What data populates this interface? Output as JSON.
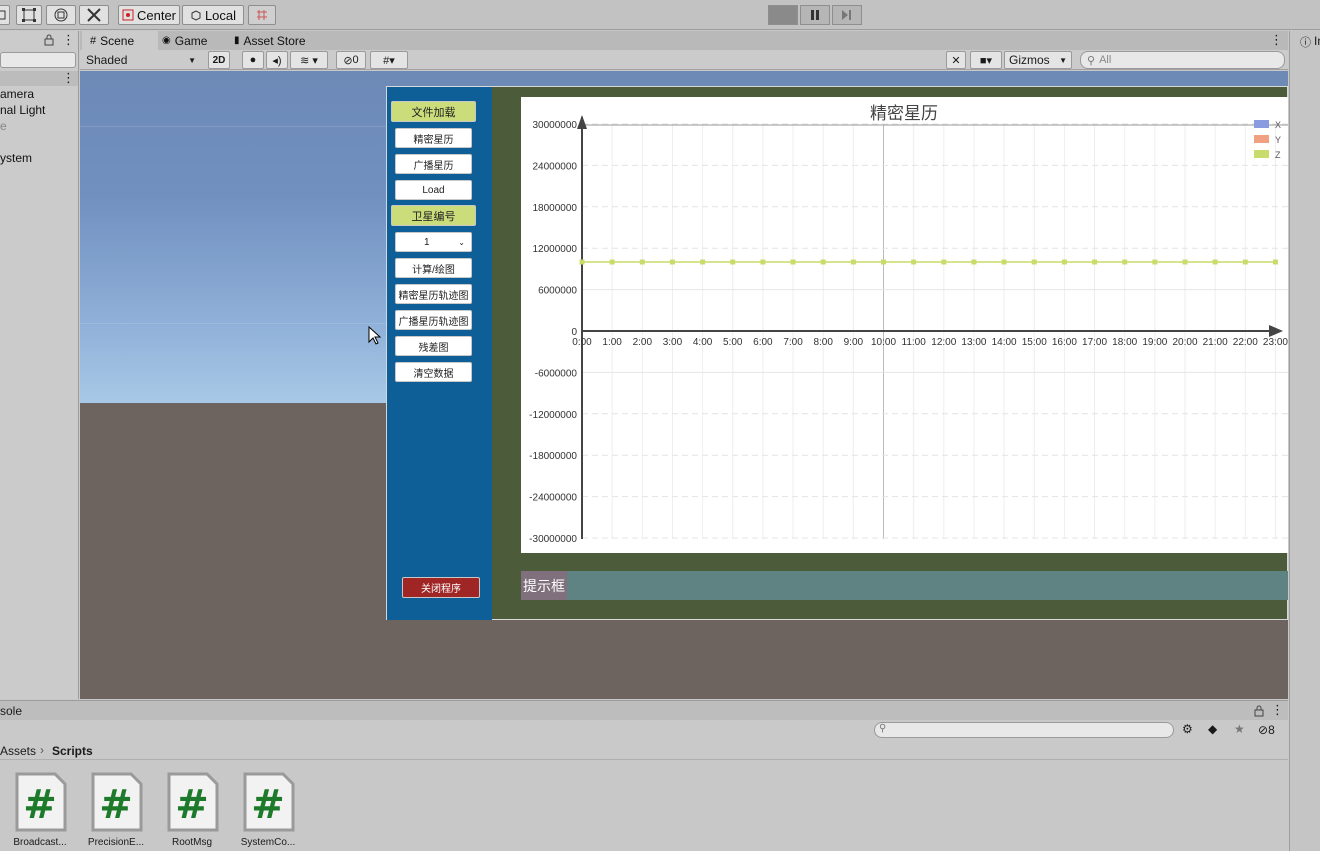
{
  "toolbar": {
    "pivot_label": "Center",
    "space_label": "Local"
  },
  "hierarchy": {
    "items": [
      "amera",
      "nal Light",
      "e",
      "ystem"
    ]
  },
  "tabs": {
    "scene": "Scene",
    "game": "Game",
    "asset_store": "Asset Store"
  },
  "scene_toolbar": {
    "shading_mode": "Shaded",
    "mode_2d": "2D",
    "hidden_count": "0",
    "gizmos": "Gizmos",
    "search_placeholder": "All"
  },
  "app_panel": {
    "buttons": [
      "文件加载",
      "精密星历",
      "广播星历",
      "Load",
      "卫星编号",
      "计算/绘图",
      "精密星历轨迹图",
      "广播星历轨迹图",
      "残差图",
      "清空数据",
      "关闭程序"
    ],
    "satellite_select": "1",
    "status_label": "提示框"
  },
  "chart_data": {
    "type": "line",
    "title": "精密星历",
    "x": [
      "0:00",
      "1:00",
      "2:00",
      "3:00",
      "4:00",
      "5:00",
      "6:00",
      "7:00",
      "8:00",
      "9:00",
      "10:00",
      "11:00",
      "12:00",
      "13:00",
      "14:00",
      "15:00",
      "16:00",
      "17:00",
      "18:00",
      "19:00",
      "20:00",
      "21:00",
      "22:00",
      "23:00"
    ],
    "ylim": [
      -30000000,
      30000000
    ],
    "yticks": [
      "30000000",
      "24000000",
      "18000000",
      "12000000",
      "6000000",
      "0",
      "-6000000",
      "-12000000",
      "-18000000",
      "-24000000",
      "-30000000"
    ],
    "legend_position": "top-right",
    "grid": true,
    "series": [
      {
        "name": "X",
        "color": "#8a9be0",
        "values": []
      },
      {
        "name": "Y",
        "color": "#f2a082",
        "values": []
      },
      {
        "name": "Z",
        "color": "#c8dc6c",
        "values": [
          10000000,
          10000000,
          10000000,
          10000000,
          10000000,
          10000000,
          10000000,
          10000000,
          10000000,
          10000000,
          10000000,
          10000000,
          10000000,
          10000000,
          10000000,
          10000000,
          10000000,
          10000000,
          10000000,
          10000000,
          10000000,
          10000000,
          10000000,
          10000000
        ]
      }
    ]
  },
  "console": {
    "title": "sole",
    "hidden_count": "8"
  },
  "breadcrumb": {
    "root": "Assets",
    "current": "Scripts"
  },
  "assets": [
    {
      "label": "Broadcast..."
    },
    {
      "label": "PrecisionE..."
    },
    {
      "label": "RootMsg"
    },
    {
      "label": "SystemCo..."
    }
  ],
  "inspector": {
    "tab": "In"
  }
}
